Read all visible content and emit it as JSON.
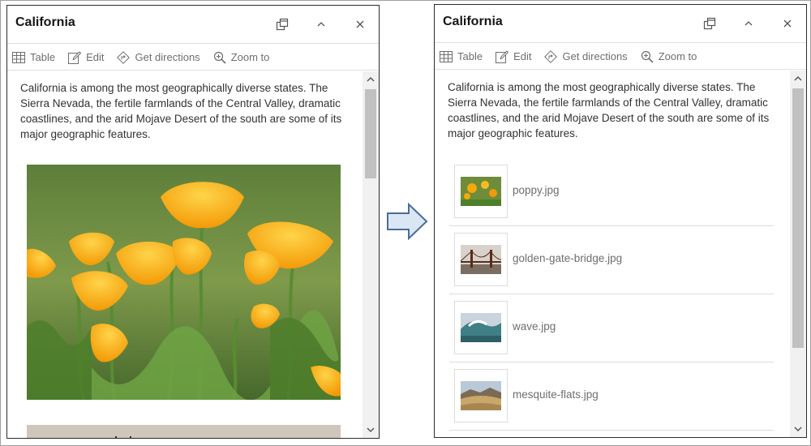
{
  "left_panel": {
    "title": "California",
    "actions": [
      {
        "label": "Table",
        "icon": "table-icon"
      },
      {
        "label": "Edit",
        "icon": "edit-icon"
      },
      {
        "label": "Get directions",
        "icon": "directions-icon"
      },
      {
        "label": "Zoom to",
        "icon": "zoom-to-icon"
      }
    ],
    "description": "California is among the most geographically diverse states. The Sierra Nevada, the fertile farmlands of the Central Valley, dramatic coastlines, and the arid Mojave Desert of the south are some of its major geographic features."
  },
  "right_panel": {
    "title": "California",
    "actions": [
      {
        "label": "Table",
        "icon": "table-icon"
      },
      {
        "label": "Edit",
        "icon": "edit-icon"
      },
      {
        "label": "Get directions",
        "icon": "directions-icon"
      },
      {
        "label": "Zoom to",
        "icon": "zoom-to-icon"
      }
    ],
    "description": "California is among the most geographically diverse states. The Sierra Nevada, the fertile farmlands of the Central Valley, dramatic coastlines, and the arid Mojave Desert of the south are some of its major geographic features.",
    "attachments": [
      {
        "name": "poppy.jpg"
      },
      {
        "name": "golden-gate-bridge.jpg"
      },
      {
        "name": "wave.jpg"
      },
      {
        "name": "mesquite-flats.jpg"
      }
    ]
  },
  "icons": {
    "dock": "dock-icon",
    "collapse": "chevron-up-icon",
    "close": "close-icon",
    "transition": "right-arrow-icon"
  },
  "colors": {
    "arrow_fill": "#dbe6f4",
    "arrow_stroke": "#4a6d98",
    "poppy": "#f7a70a"
  }
}
